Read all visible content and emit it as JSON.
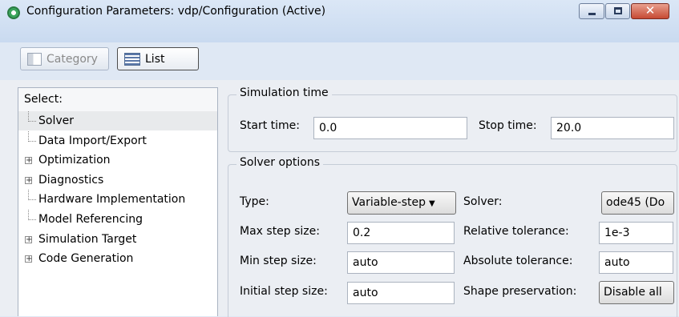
{
  "window": {
    "title": "Configuration Parameters: vdp/Configuration (Active)",
    "close_symbol": "✕"
  },
  "toolbar": {
    "category_label": "Category",
    "list_label": "List"
  },
  "tree": {
    "header": "Select:",
    "items": [
      {
        "label": "Solver",
        "expandable": false,
        "selected": true
      },
      {
        "label": "Data Import/Export",
        "expandable": false
      },
      {
        "label": "Optimization",
        "expandable": true
      },
      {
        "label": "Diagnostics",
        "expandable": true
      },
      {
        "label": "Hardware Implementation",
        "expandable": false
      },
      {
        "label": "Model Referencing",
        "expandable": false
      },
      {
        "label": "Simulation Target",
        "expandable": true
      },
      {
        "label": "Code Generation",
        "expandable": true
      }
    ],
    "expand_symbol": "+"
  },
  "simulation_time": {
    "legend": "Simulation time",
    "start_label": "Start time:",
    "start_value": "0.0",
    "stop_label": "Stop time:",
    "stop_value": "20.0"
  },
  "solver_options": {
    "legend": "Solver options",
    "type_label": "Type:",
    "type_value": "Variable-step",
    "dropdown_caret": "▼",
    "solver_label": "Solver:",
    "solver_value": "ode45 (Do",
    "max_step_label": "Max step size:",
    "max_step_value": "0.2",
    "rel_tol_label": "Relative tolerance:",
    "rel_tol_value": "1e-3",
    "min_step_label": "Min step size:",
    "min_step_value": "auto",
    "abs_tol_label": "Absolute tolerance:",
    "abs_tol_value": "auto",
    "init_step_label": "Initial step size:",
    "init_step_value": "auto",
    "shape_label": "Shape preservation:",
    "shape_value": "Disable all"
  }
}
